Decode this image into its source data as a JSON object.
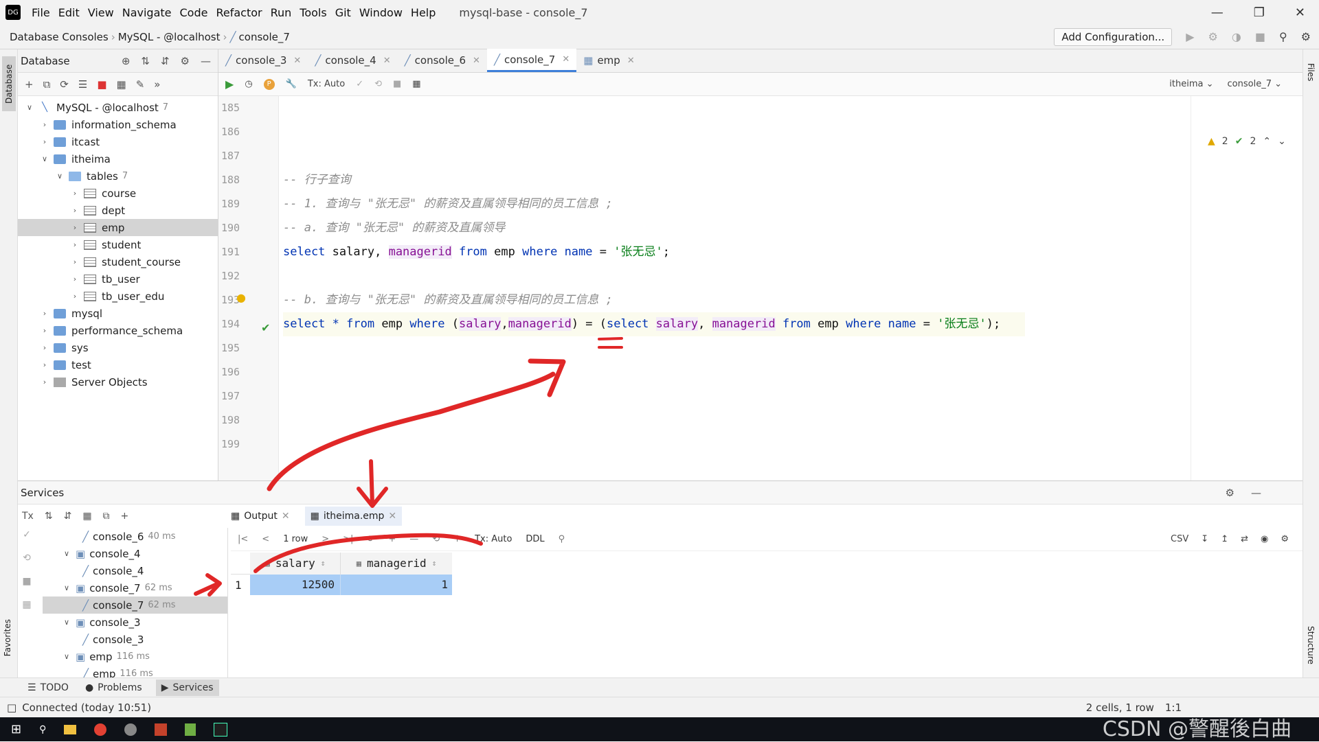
{
  "menu": {
    "items": [
      "File",
      "Edit",
      "View",
      "Navigate",
      "Code",
      "Refactor",
      "Run",
      "Tools",
      "Git",
      "Window",
      "Help"
    ],
    "window_title": "mysql-base - console_7"
  },
  "nav": {
    "crumbs": [
      "Database Consoles",
      "MySQL - @localhost",
      "console_7"
    ],
    "add_config": "Add Configuration..."
  },
  "db_panel": {
    "title": "Database",
    "tree": [
      {
        "label": "MySQL - @localhost",
        "count": "7",
        "level": 0,
        "icon": "mysql",
        "expanded": true
      },
      {
        "label": "information_schema",
        "level": 1,
        "icon": "db"
      },
      {
        "label": "itcast",
        "level": 1,
        "icon": "db"
      },
      {
        "label": "itheima",
        "level": 1,
        "icon": "db",
        "expanded": true
      },
      {
        "label": "tables",
        "count": "7",
        "level": 2,
        "icon": "folder",
        "expanded": true
      },
      {
        "label": "course",
        "level": 3,
        "icon": "tbl"
      },
      {
        "label": "dept",
        "level": 3,
        "icon": "tbl"
      },
      {
        "label": "emp",
        "level": 3,
        "icon": "tbl",
        "selected": true
      },
      {
        "label": "student",
        "level": 3,
        "icon": "tbl"
      },
      {
        "label": "student_course",
        "level": 3,
        "icon": "tbl"
      },
      {
        "label": "tb_user",
        "level": 3,
        "icon": "tbl"
      },
      {
        "label": "tb_user_edu",
        "level": 3,
        "icon": "tbl"
      },
      {
        "label": "mysql",
        "level": 1,
        "icon": "db"
      },
      {
        "label": "performance_schema",
        "level": 1,
        "icon": "db"
      },
      {
        "label": "sys",
        "level": 1,
        "icon": "db"
      },
      {
        "label": "test",
        "level": 1,
        "icon": "db"
      },
      {
        "label": "Server Objects",
        "level": 1,
        "icon": "srv"
      }
    ]
  },
  "editor": {
    "tabs": [
      {
        "label": "console_3"
      },
      {
        "label": "console_4"
      },
      {
        "label": "console_6"
      },
      {
        "label": "console_7",
        "active": true
      },
      {
        "label": "emp"
      }
    ],
    "toolbar": {
      "tx": "Tx: Auto",
      "schema": "itheima",
      "console": "console_7"
    },
    "inspections": {
      "warnings": "2",
      "ok": "2"
    },
    "line_numbers": [
      "185",
      "186",
      "187",
      "188",
      "189",
      "190",
      "191",
      "192",
      "193",
      "194",
      "195",
      "196",
      "197",
      "198",
      "199"
    ],
    "comments": {
      "l188": "-- 行子查询",
      "l189": "-- 1. 查询与 \"张无忌\" 的薪资及直属领导相同的员工信息 ;",
      "l190": "-- a. 查询 \"张无忌\" 的薪资及直属领导",
      "l193": "-- b. 查询与 \"张无忌\" 的薪资及直属领导相同的员工信息 ;"
    },
    "tokens": {
      "select": "select",
      "from": "from",
      "where": "where",
      "salary": "salary",
      "managerid": "managerid",
      "emp": "emp",
      "name": "name",
      "star": "*",
      "str": "'张无忌'"
    }
  },
  "services": {
    "title": "Services",
    "tree": [
      {
        "label": "console_6",
        "time": "40 ms",
        "level": 2
      },
      {
        "label": "console_4",
        "level": 1,
        "expanded": true
      },
      {
        "label": "console_4",
        "level": 2
      },
      {
        "label": "console_7",
        "time": "62 ms",
        "level": 1,
        "expanded": true
      },
      {
        "label": "console_7",
        "time": "62 ms",
        "level": 2,
        "selected": true
      },
      {
        "label": "console_3",
        "level": 1,
        "expanded": true
      },
      {
        "label": "console_3",
        "level": 2
      },
      {
        "label": "emp",
        "time": "116 ms",
        "level": 1,
        "expanded": true
      },
      {
        "label": "emp",
        "time": "116 ms",
        "level": 2
      }
    ],
    "result_tabs": [
      {
        "label": "Output"
      },
      {
        "label": "itheima.emp",
        "active": true
      }
    ],
    "result_toolbar": {
      "rows": "1 row",
      "tx": "Tx: Auto",
      "ddl": "DDL",
      "csv": "CSV"
    },
    "columns": [
      "salary",
      "managerid"
    ],
    "rows": [
      {
        "num": "1",
        "salary": "12500",
        "managerid": "1"
      }
    ]
  },
  "bottom_tabs": [
    "TODO",
    "Problems",
    "Services"
  ],
  "status": {
    "left": "Connected (today 10:51)",
    "right": "2 cells, 1 row",
    "pos": "1:1"
  },
  "watermark": "CSDN @警醒後白曲",
  "colors": {
    "accent": "#3d7fd9",
    "annotation": "#e02727",
    "keyword": "#0033b3",
    "string": "#067d17",
    "field": "#871094"
  }
}
